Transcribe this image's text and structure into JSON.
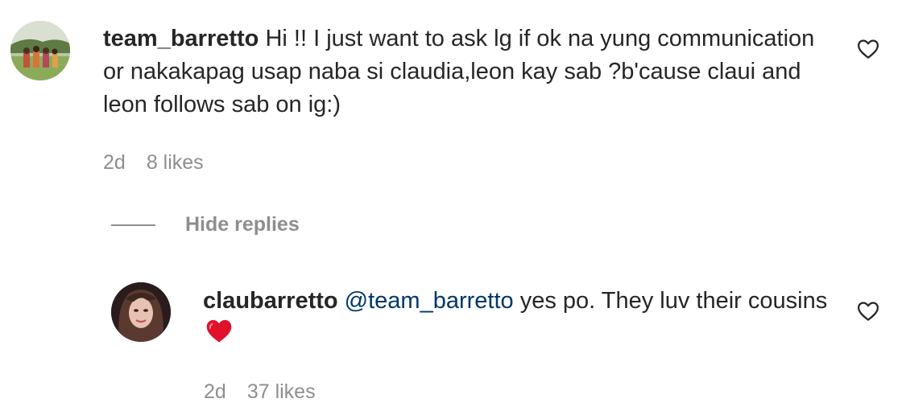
{
  "comment": {
    "username": "team_barretto",
    "text": "Hi !! I just want to ask lg if ok na yung communication or nakakapag usap naba si claudia,leon kay sab ?b'cause claui and leon follows sab on ig:)",
    "time": "2d",
    "likes": "8 likes",
    "like_icon": "heart-outline-icon"
  },
  "replies_toggle": {
    "label": "Hide replies"
  },
  "reply": {
    "username": "claubarretto",
    "mention": "@team_barretto",
    "text": "yes po. They luv their cousins",
    "emoji": "red-heart-emoji",
    "time": "2d",
    "likes": "37 likes",
    "like_icon": "heart-outline-icon"
  },
  "colors": {
    "text": "#262626",
    "secondary": "#8e8e8e",
    "mention": "#00376b",
    "emoji_heart": "#e0112b"
  }
}
